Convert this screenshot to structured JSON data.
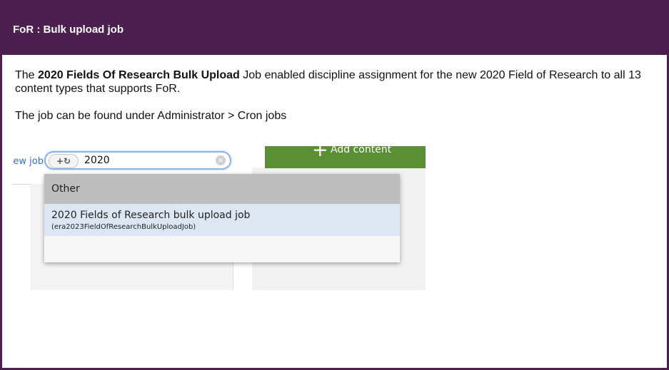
{
  "panel": {
    "title": "FoR : Bulk upload job",
    "accent_color": "#4b1f4e"
  },
  "body": {
    "p1_prefix": "The ",
    "p1_bold": "2020 Fields Of Research Bulk Upload",
    "p1_suffix": " Job enabled discipline assignment for the new 2020 Field of Research to all 13 content types that supports FoR.",
    "p2": "The job can be found under Administrator > Cron jobs"
  },
  "screenshot": {
    "new_job_link": "New job",
    "add_content_icon": "plus-icon",
    "add_content_label": "Add content",
    "add_content_color": "#5a9033",
    "search": {
      "chip_icon": "add-refresh-icon",
      "chip_glyph": "+↻",
      "value": "2020",
      "clear_icon": "clear-icon",
      "clear_glyph": "×"
    },
    "dropdown": {
      "group_label": "Other",
      "item_title": "2020 Fields of Research bulk upload job",
      "item_subtitle": "(era2023FieldOfResearchBulkUploadJob)"
    }
  }
}
